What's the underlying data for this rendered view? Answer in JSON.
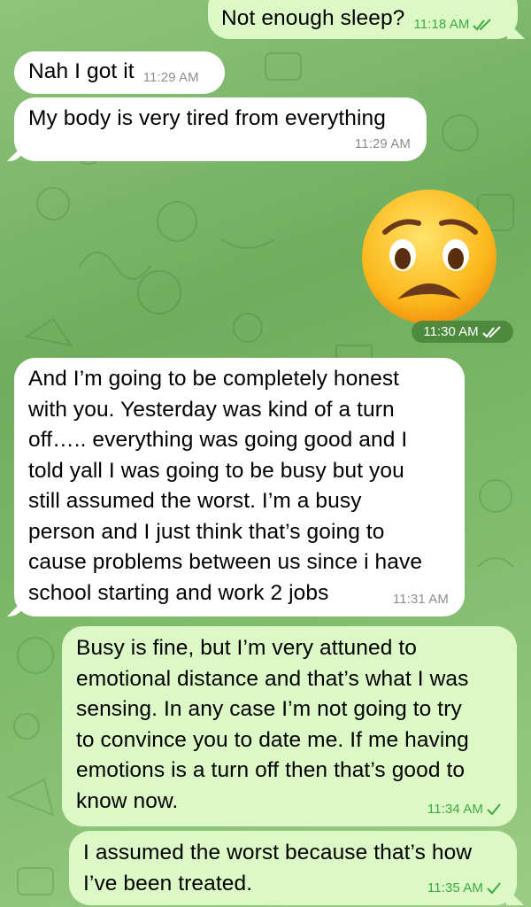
{
  "colors": {
    "incoming_bubble": "#ffffff",
    "outgoing_bubble": "#dbf8c6",
    "outgoing_meta": "#3faa3f",
    "incoming_meta": "#8e8e93",
    "wallpaper": "#7dba6a"
  },
  "messages": [
    {
      "direction": "outgoing",
      "text": "Not enough sleep?",
      "time": "11:18 AM",
      "status": "read-double-check-icon"
    },
    {
      "direction": "incoming",
      "text": "Nah I got it",
      "time": "11:29 AM"
    },
    {
      "direction": "incoming",
      "text": "My body is very tired from everything",
      "time": "11:29 AM"
    },
    {
      "direction": "outgoing",
      "type": "emoji-sticker",
      "emoji": "anxious-face-emoji",
      "time": "11:30 AM",
      "status": "read-double-check-icon"
    },
    {
      "direction": "incoming",
      "text": "And I’m going to be completely honest\nwith you. Yesterday was kind of a turn\noff….. everything was going good and I\ntold yall I was going to be busy but you\nstill assumed the worst. I’m a busy\nperson and I just think that’s going to\ncause problems between us since i have\nschool starting and work 2 jobs",
      "time": "11:31 AM"
    },
    {
      "direction": "outgoing",
      "text": "Busy is fine, but I’m very attuned to\nemotional distance and that’s what I was\nsensing. In any case I’m not going to try\nto convince you to date me. If me having\nemotions is a turn off then that’s good to\nknow now.",
      "time": "11:34 AM",
      "status": "sent-check-icon"
    },
    {
      "direction": "outgoing",
      "text": "I assumed the worst because that’s how\nI’ve been treated.",
      "time": "11:35 AM",
      "status": "sent-check-icon"
    }
  ]
}
